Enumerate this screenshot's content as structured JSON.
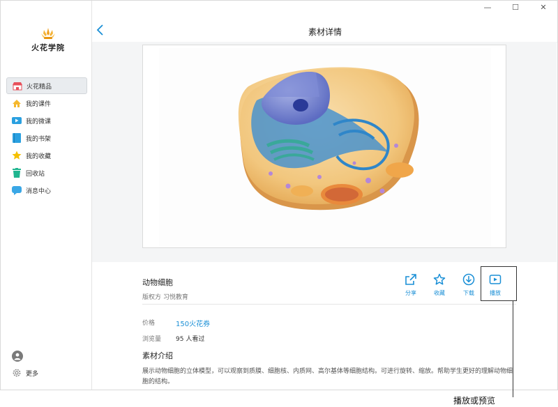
{
  "window": {
    "minimize": "—",
    "maximize": "☐",
    "close": "✕"
  },
  "logo": {
    "text": "火花学院"
  },
  "sidebar": {
    "items": [
      {
        "label": "火花精品",
        "icon": "shop-icon",
        "active": true
      },
      {
        "label": "我的课件",
        "icon": "home-icon"
      },
      {
        "label": "我的微课",
        "icon": "video-icon"
      },
      {
        "label": "我的书架",
        "icon": "book-icon"
      },
      {
        "label": "我的收藏",
        "icon": "star-icon"
      },
      {
        "label": "回收站",
        "icon": "trash-icon"
      },
      {
        "label": "消息中心",
        "icon": "message-icon"
      }
    ],
    "more_label": "更多"
  },
  "header": {
    "title": "素材详情"
  },
  "material": {
    "title": "动物细胞",
    "copyright": "版权方 习悦教育",
    "price_label": "价格",
    "price_value": "150火花券",
    "views_label": "浏览量",
    "views_value": "95 人看过",
    "intro_title": "素材介绍",
    "intro_text": "展示动物细胞的立体模型，可以观察到质膜、细胞核、内质网、高尔基体等细胞结构。可进行旋转、缩放。帮助学生更好的理解动物细胞的结构。"
  },
  "actions": {
    "share": "分享",
    "favorite": "收藏",
    "download": "下载",
    "play": "播放"
  },
  "annotation": {
    "text": "播放或预览"
  },
  "colors": {
    "accent": "#1a8fd6",
    "logo": "#f0a020"
  }
}
